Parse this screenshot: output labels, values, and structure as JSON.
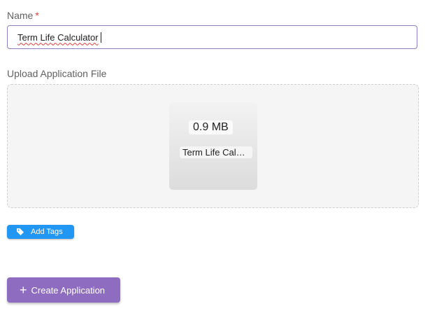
{
  "form": {
    "name_label": "Name",
    "required_marker": "*",
    "name_value": "Term Life Calculator",
    "upload_label": "Upload Application File"
  },
  "file": {
    "size": "0.9 MB",
    "name": "Term Life Calculator"
  },
  "buttons": {
    "add_tags": "Add Tags",
    "add_tags_icon": "tag-icon",
    "create": "Create Application",
    "create_icon": "plus-icon"
  },
  "colors": {
    "input_border": "#8e7cc3",
    "tags_button": "#2196f3",
    "create_button": "#8e6cbf",
    "required": "#e53935"
  }
}
